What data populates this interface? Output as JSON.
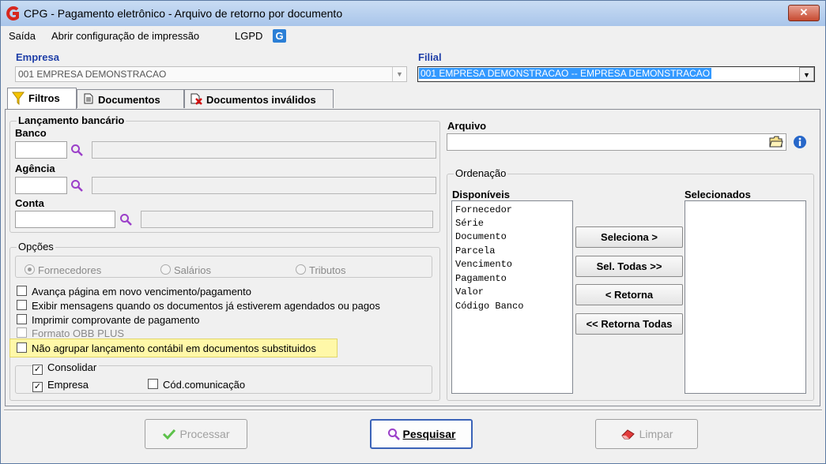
{
  "window": {
    "title": "CPG - Pagamento eletrônico - Arquivo de retorno por documento",
    "close_label": "✕"
  },
  "menu": {
    "items": [
      "Saída",
      "Abrir configuração de impressão",
      "LGPD"
    ]
  },
  "empresa": {
    "label": "Empresa",
    "value": "001 EMPRESA DEMONSTRACAO"
  },
  "filial": {
    "label": "Filial",
    "value": "001 EMPRESA DEMONSTRACAO -- EMPRESA DEMONSTRACAO"
  },
  "tabs": [
    {
      "label": "Filtros",
      "icon": "filter-icon",
      "selected": true
    },
    {
      "label": "Documentos",
      "icon": "document-icon",
      "selected": false
    },
    {
      "label": "Documentos inválidos",
      "icon": "invalid-document-icon",
      "selected": false
    }
  ],
  "lancamento": {
    "legend": "Lançamento bancário",
    "banco_label": "Banco",
    "agencia_label": "Agência",
    "conta_label": "Conta"
  },
  "opcoes": {
    "legend": "Opções",
    "radios": [
      {
        "label": "Fornecedores",
        "selected": true
      },
      {
        "label": "Salários",
        "selected": false
      },
      {
        "label": "Tributos",
        "selected": false
      }
    ],
    "checks": [
      {
        "label": "Avança página em novo vencimento/pagamento",
        "checked": false,
        "enabled": true
      },
      {
        "label": "Exibir mensagens quando os documentos já estiverem agendados ou pagos",
        "checked": false,
        "enabled": true
      },
      {
        "label": "Imprimir comprovante de pagamento",
        "checked": false,
        "enabled": true
      },
      {
        "label": "Formato OBB PLUS",
        "checked": false,
        "enabled": false
      },
      {
        "label": "Não agrupar lançamento contábil em documentos substituidos",
        "checked": false,
        "enabled": true,
        "highlighted": true
      }
    ],
    "consolidar": {
      "label": "Consolidar",
      "checked": true
    },
    "empresa_check": {
      "label": "Empresa",
      "checked": true
    },
    "cod_check": {
      "label": "Cód.comunicação",
      "checked": false
    }
  },
  "arquivo": {
    "label": "Arquivo",
    "value": ""
  },
  "ordenacao": {
    "legend": "Ordenação",
    "disponiveis_label": "Disponíveis",
    "selecionados_label": "Selecionados",
    "disponiveis": [
      "Fornecedor",
      "Série",
      "Documento",
      "Parcela",
      "Vencimento",
      "Pagamento",
      "Valor",
      "Código Banco"
    ],
    "selecionados": [],
    "buttons": {
      "seleciona": "Seleciona >",
      "sel_todas": "Sel. Todas >>",
      "retorna": "< Retorna",
      "retorna_todas": "<< Retorna Todas"
    }
  },
  "actions": {
    "processar": "Processar",
    "pesquisar": "Pesquisar",
    "limpar": "Limpar"
  },
  "colors": {
    "label_blue": "#1f3fa8",
    "search_purple": "#9b3fc9",
    "highlight": "#fff8a8",
    "primary_border": "#3b63b8"
  }
}
